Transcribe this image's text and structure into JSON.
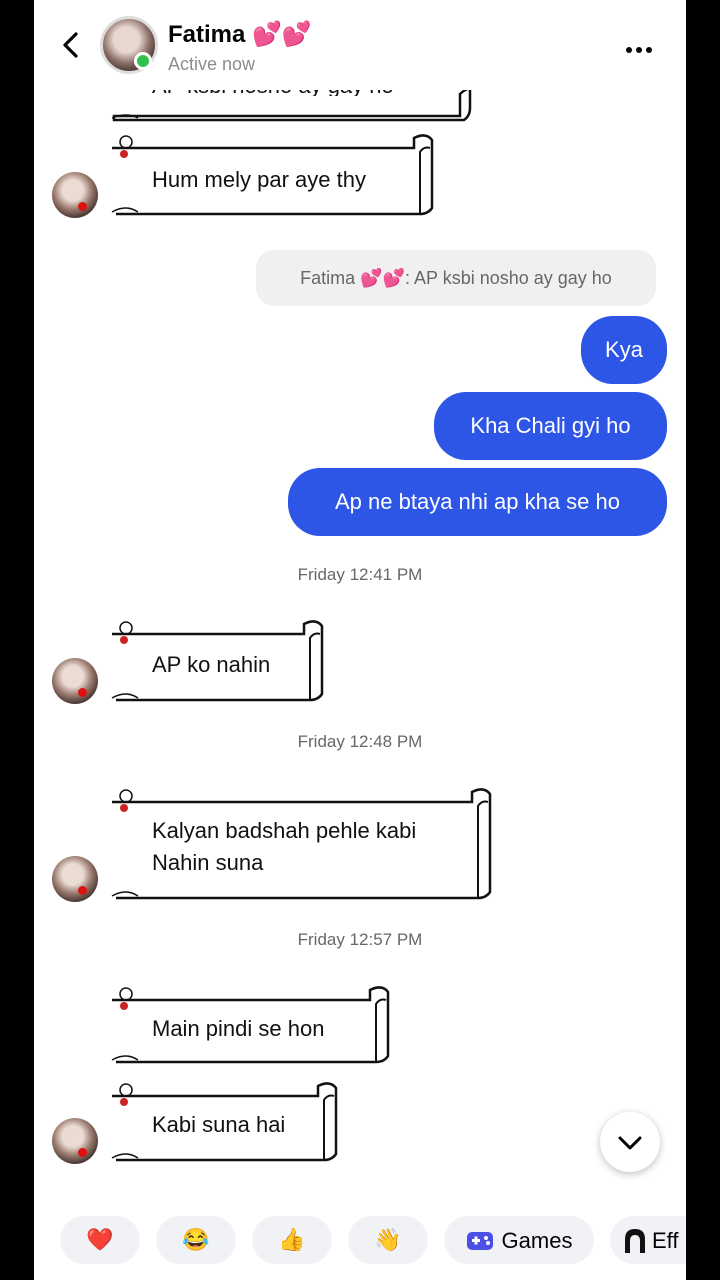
{
  "header": {
    "name": "Fatima 💕💕",
    "status": "Active now"
  },
  "messages": {
    "partial_top": "AP ksbi nosho ay gay ho",
    "m1": "Hum mely par aye thy",
    "reply_preview": "Fatima 💕💕: AP ksbi nosho ay gay ho",
    "sent1": "Kya",
    "sent2": "Kha Chali gyi ho",
    "sent3": "Ap ne btaya nhi ap kha se ho",
    "time1": "Friday 12:41 PM",
    "m2": "AP ko nahin",
    "time2": "Friday 12:48 PM",
    "m3": "Kalyan badshah pehle kabi\nNahin suna",
    "time3": "Friday 12:57 PM",
    "m4": "Main pindi se hon",
    "m5": "Kabi suna hai"
  },
  "quick_replies": {
    "heart": "❤️",
    "laugh": "😂",
    "thumbs": "👍",
    "wave": "👋",
    "games": "Games",
    "effects": "Eff"
  },
  "colors": {
    "sent_bubble": "#2d55e6",
    "online": "#31c24d"
  }
}
